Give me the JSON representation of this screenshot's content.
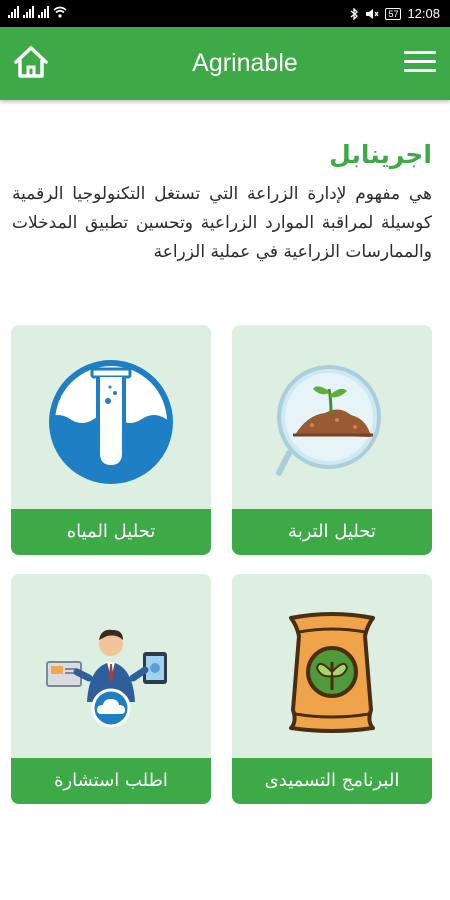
{
  "status_bar": {
    "time": "12:08",
    "battery": "57"
  },
  "app_bar": {
    "title": "Agrinable"
  },
  "intro": {
    "title": "اجرينابل",
    "text": "هي مفهوم لإدارة الزراعة التي تستغل التكنولوجيا الرقمية كوسيلة لمراقبة الموارد الزراعية وتحسين تطبيق المدخلات والممارسات الزراعية في عملية الزراعة"
  },
  "cards": {
    "soil": {
      "label": "تحليل التربة"
    },
    "water": {
      "label": "تحليل المياه"
    },
    "fert": {
      "label": "البرنامج التسميدى"
    },
    "consult": {
      "label": "اطلب استشارة"
    }
  },
  "colors": {
    "primary": "#3daa47",
    "card_bg": "#dcefe0",
    "water_blue": "#1e7fc4"
  }
}
